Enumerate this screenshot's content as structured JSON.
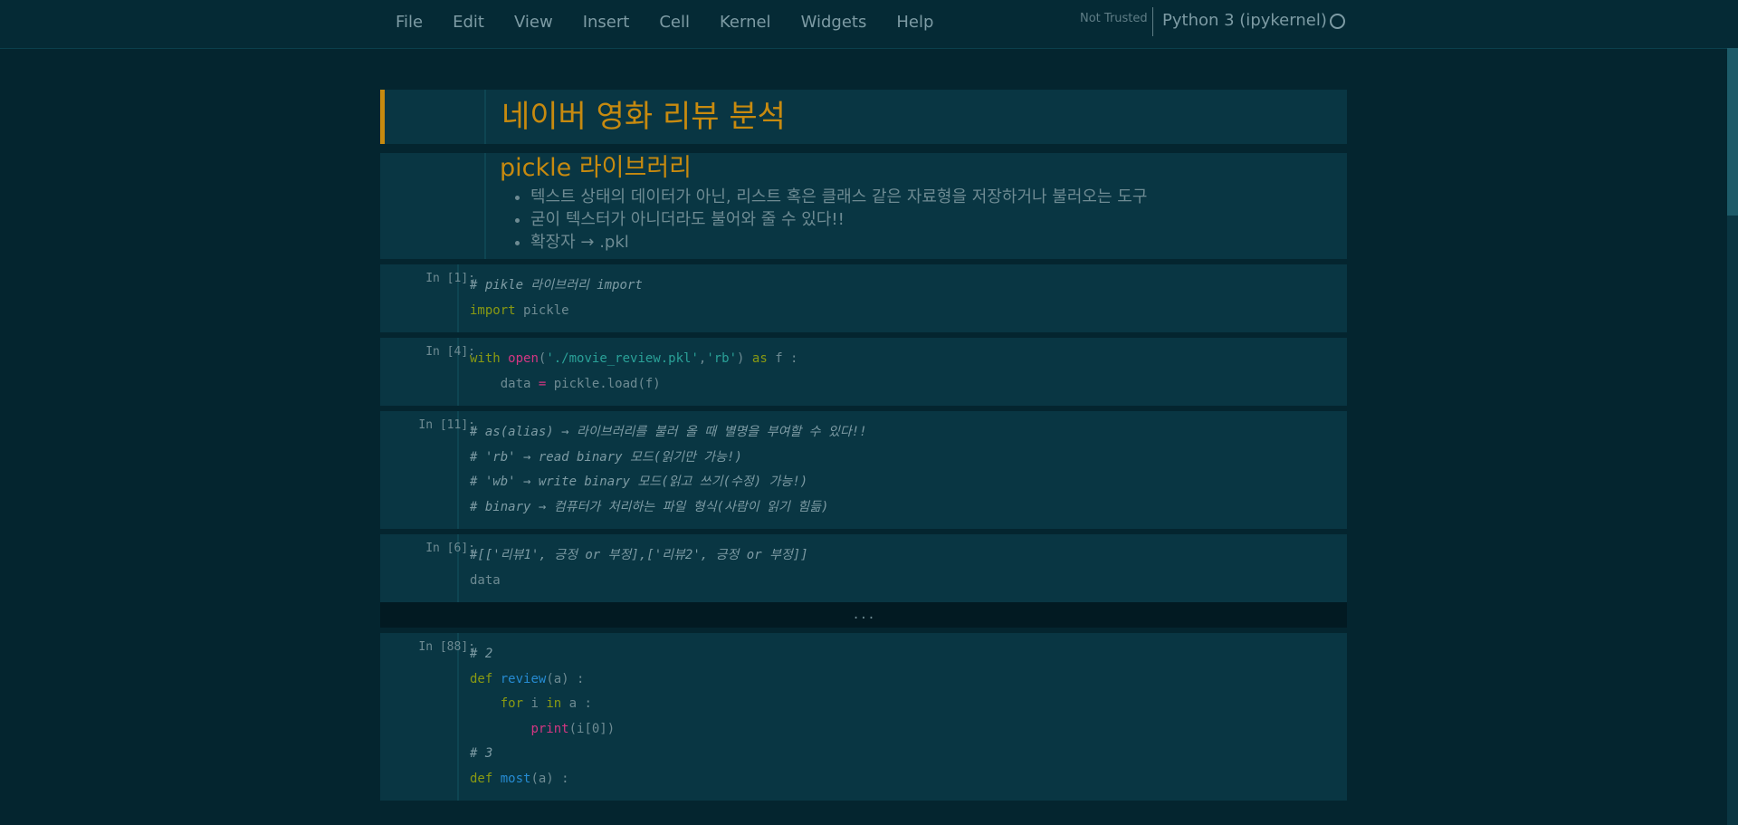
{
  "menubar": {
    "items": [
      {
        "label": "File"
      },
      {
        "label": "Edit"
      },
      {
        "label": "View"
      },
      {
        "label": "Insert"
      },
      {
        "label": "Cell"
      },
      {
        "label": "Kernel"
      },
      {
        "label": "Widgets"
      },
      {
        "label": "Help"
      }
    ],
    "trust_status": "Not Trusted",
    "kernel_name": "Python 3 (ipykernel)"
  },
  "cells": {
    "title": {
      "text": "네이버 영화 리뷰 분석"
    },
    "pickle": {
      "heading": "pickle 라이브러리",
      "bullets": [
        "텍스트 상태의 데이터가 아닌, 리스트 혹은 클래스 같은 자료형을 저장하거나 불러오는 도구",
        "굳이 텍스터가 아니더라도 불어와 줄 수 있다!!",
        "확장자 → .pkl"
      ]
    },
    "c1": {
      "prompt": "In [1]:",
      "line1": "# pikle 라이브러리 import",
      "kw": "import",
      "rest": " pickle"
    },
    "c2": {
      "prompt": "In [4]:",
      "l1_with": "with",
      "l1_open": "open",
      "l1_p1": "(",
      "l1_str1": "'./movie_review.pkl'",
      "l1_comma": ",",
      "l1_str2": "'rb'",
      "l1_p2": ") ",
      "l1_as": "as",
      "l1_f": " f :",
      "l2_a": "    data ",
      "l2_eq": "=",
      "l2_b": " pickle.load(f)"
    },
    "c3": {
      "prompt": "In [11]:",
      "lines": [
        "# as(alias) → 라이브러리를 불러 올 때 별명을 부여할 수 있다!!",
        "# 'rb' → read binary 모드(읽기만 가능!)",
        "# 'wb' → write binary 모드(읽고 쓰기(수정) 가능!)",
        "# binary → 컴퓨터가 처리하는 파일 형식(사람이 읽기 힘듦)"
      ]
    },
    "c4": {
      "prompt": "In [6]:",
      "line1": "#[['리뷰1', 긍정 or 부정],['리뷰2', 긍정 or 부정]]",
      "line2": "data"
    },
    "collapsed": {
      "text": "..."
    },
    "c5": {
      "prompt": "In [88]:",
      "l1": "# 2",
      "l2_def": "def",
      "l2_fn": " review",
      "l2_rest": "(a) :",
      "l3_ind": "    ",
      "l3_for": "for",
      "l3_mid": " i ",
      "l3_in": "in",
      "l3_rest": " a :",
      "l4_ind": "        ",
      "l4_print": "print",
      "l4_rest": "(i[0])",
      "l5": "# 3",
      "l6_def": "def",
      "l6_fn": " most",
      "l6_rest": "(a) :"
    }
  }
}
